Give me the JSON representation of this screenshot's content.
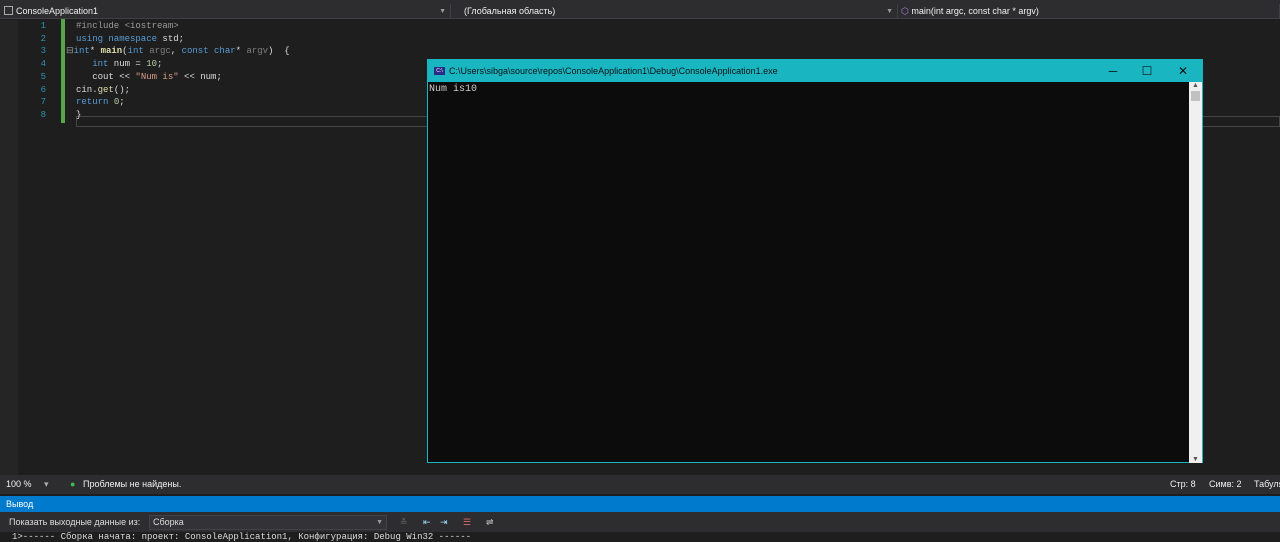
{
  "nav": {
    "project": "ConsoleApplication1",
    "scope": "(Глобальная область)",
    "member": "main(int argc, const char * argv)"
  },
  "editor": {
    "line_numbers": [
      "1",
      "2",
      "3",
      "4",
      "5",
      "6",
      "7",
      "8"
    ]
  },
  "console": {
    "title": "C:\\Users\\sibga\\source\\repos\\ConsoleApplication1\\Debug\\ConsoleApplication1.exe",
    "output": "Num is10",
    "icon": "console-icon"
  },
  "status": {
    "zoom": "100 %",
    "problems": "Проблемы не найдены.",
    "line": "Стр: 8",
    "col": "Симв: 2",
    "tabs": "Табуля"
  },
  "output": {
    "title": "Вывод",
    "show_from_label": "Показать выходные данные из:",
    "source": "Сборка",
    "first_line": "1>------ Сборка начата: проект: ConsoleApplication1, Конфигурация: Debug Win32 ------"
  },
  "colors": {
    "accent": "#007acc",
    "console_title": "#19b6c2"
  }
}
